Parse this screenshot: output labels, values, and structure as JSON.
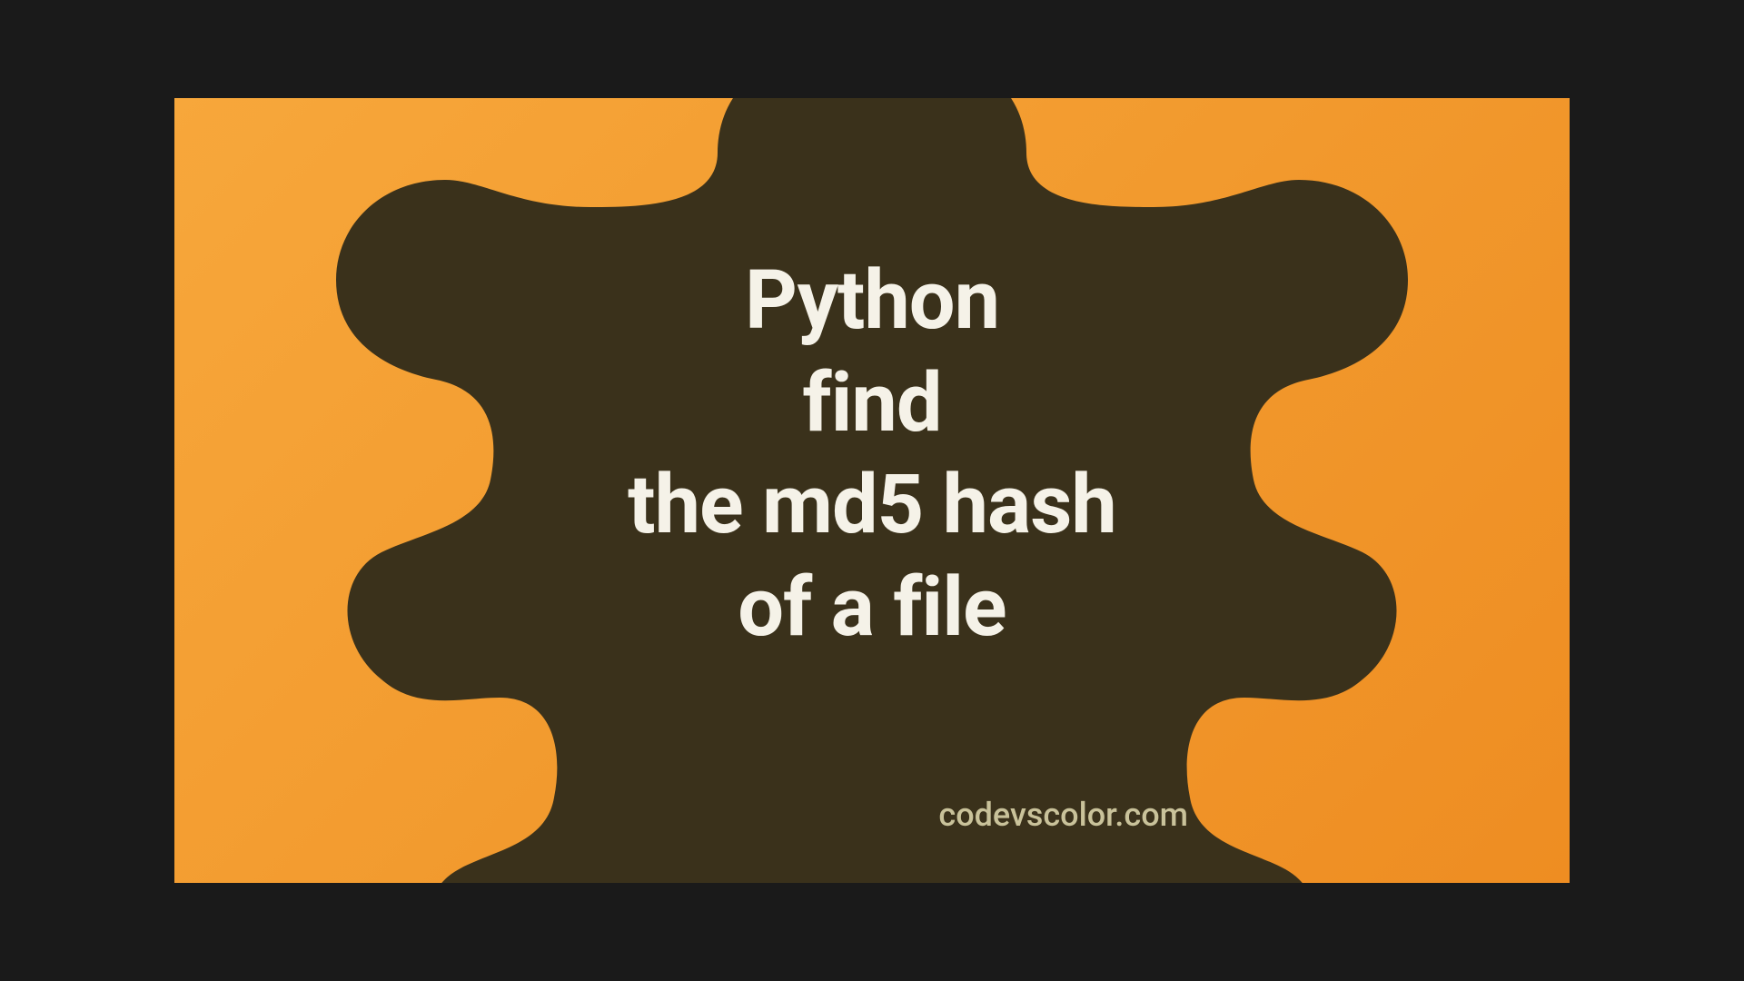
{
  "title": {
    "line1": "Python",
    "line2": "find",
    "line3": "the md5 hash",
    "line4": "of a file"
  },
  "watermark": "codevscolor.com",
  "colors": {
    "bg_gradient_start": "#f7a73b",
    "bg_gradient_end": "#ee8d22",
    "blob": "#3a311b",
    "text": "#f5f2e8",
    "watermark": "#c9c29a"
  }
}
